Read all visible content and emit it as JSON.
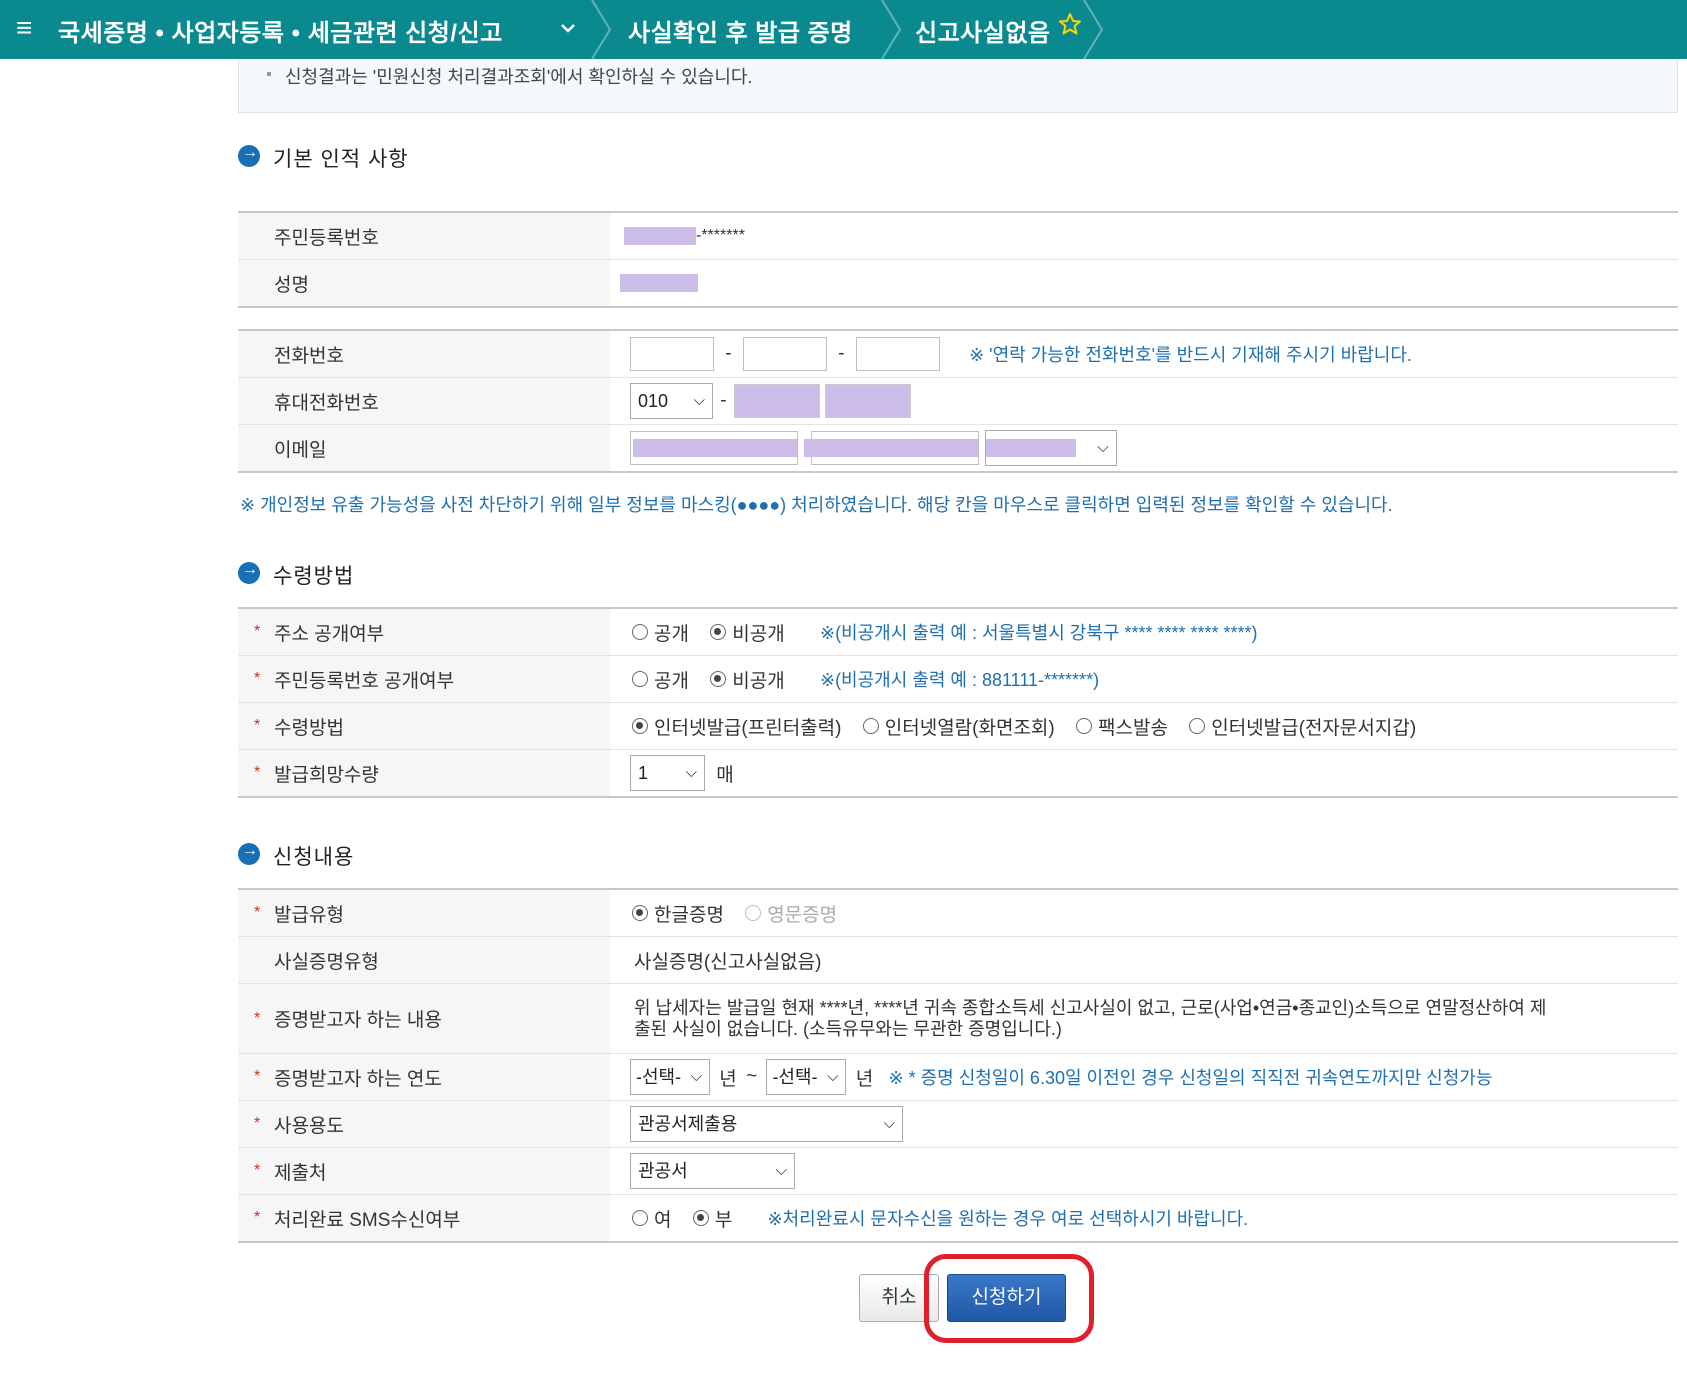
{
  "topbar": {
    "menu_icon": "hamburger-icon",
    "crumb1": "국세증명 • 사업자등록 • 세금관련 신청/신고",
    "crumb2": "사실확인 후 발급 증명",
    "crumb3": "신고사실없음",
    "star_icon": "star-outline-icon"
  },
  "notice": "신청결과는 '민원신청 처리결과조회'에서 확인하실 수 있습니다.",
  "basic": {
    "title": "기본 인적 사항",
    "rrn_label": "주민등록번호",
    "rrn_suffix": "-*******",
    "name_label": "성명"
  },
  "contact": {
    "phone_label": "전화번호",
    "phone_hint": "※ '연락 가능한 전화번호'를 반드시 기재해 주시기 바랍니다.",
    "mobile_label": "휴대전화번호",
    "mobile_prefix": "010",
    "email_label": "이메일",
    "dash": "-"
  },
  "mask_note": "※ 개인정보 유출 가능성을 사전 차단하기 위해 일부 정보를 마스킹(●●●●) 처리하였습니다. 해당 칸을 마우스로 클릭하면 입력된 정보를 확인할 수 있습니다.",
  "receive": {
    "title": "수령방법",
    "addr_label": "주소 공개여부",
    "addr_opt1": "공개",
    "addr_opt2": "비공개",
    "addr_hint": "※(비공개시 출력 예 : 서울특별시 강북구 **** **** **** ****)",
    "rrn_label": "주민등록번호 공개여부",
    "rrn_opt1": "공개",
    "rrn_opt2": "비공개",
    "rrn_hint": "※(비공개시 출력 예 : 881111-*******)",
    "method_label": "수령방법",
    "method_opts": [
      "인터넷발급(프린터출력)",
      "인터넷열람(화면조회)",
      "팩스발송",
      "인터넷발급(전자문서지갑)"
    ],
    "qty_label": "발급희망수량",
    "qty_value": "1",
    "qty_unit": "매"
  },
  "apply": {
    "title": "신청내용",
    "type_label": "발급유형",
    "type_opt1": "한글증명",
    "type_opt2": "영문증명",
    "fact_label": "사실증명유형",
    "fact_value": "사실증명(신고사실없음)",
    "content_label": "증명받고자 하는 내용",
    "content_line1": "위 납세자는 발급일 현재 ****년, ****년 귀속 종합소득세 신고사실이 없고, 근로(사업•연금•종교인)소득으로 연말정산하여 제",
    "content_line2": "출된 사실이 없습니다. (소득유무와는 무관한 증명입니다.)",
    "year_label": "증명받고자 하는 연도",
    "year_from": "-선택-",
    "year_unit": "년",
    "tilde": "~",
    "year_to": "-선택-",
    "year_hint": "※ * 증명 신청일이 6.30일 이전인 경우 신청일의 직직전 귀속연도까지만 신청가능",
    "use_label": "사용용도",
    "use_value": "관공서제출용",
    "submit_to_label": "제출처",
    "submit_to_value": "관공서",
    "sms_label": "처리완료 SMS수신여부",
    "sms_opt1": "여",
    "sms_opt2": "부",
    "sms_hint": "※처리완료시 문자수신을 원하는 경우 여로 선택하시기 바랍니다."
  },
  "buttons": {
    "cancel": "취소",
    "submit": "신청하기"
  },
  "colors": {
    "topbar": "#0a8a8f",
    "hint": "#1f6fb0",
    "mask": "#cbbde8",
    "required": "#d52b1e",
    "highlight": "#e01f2a"
  }
}
